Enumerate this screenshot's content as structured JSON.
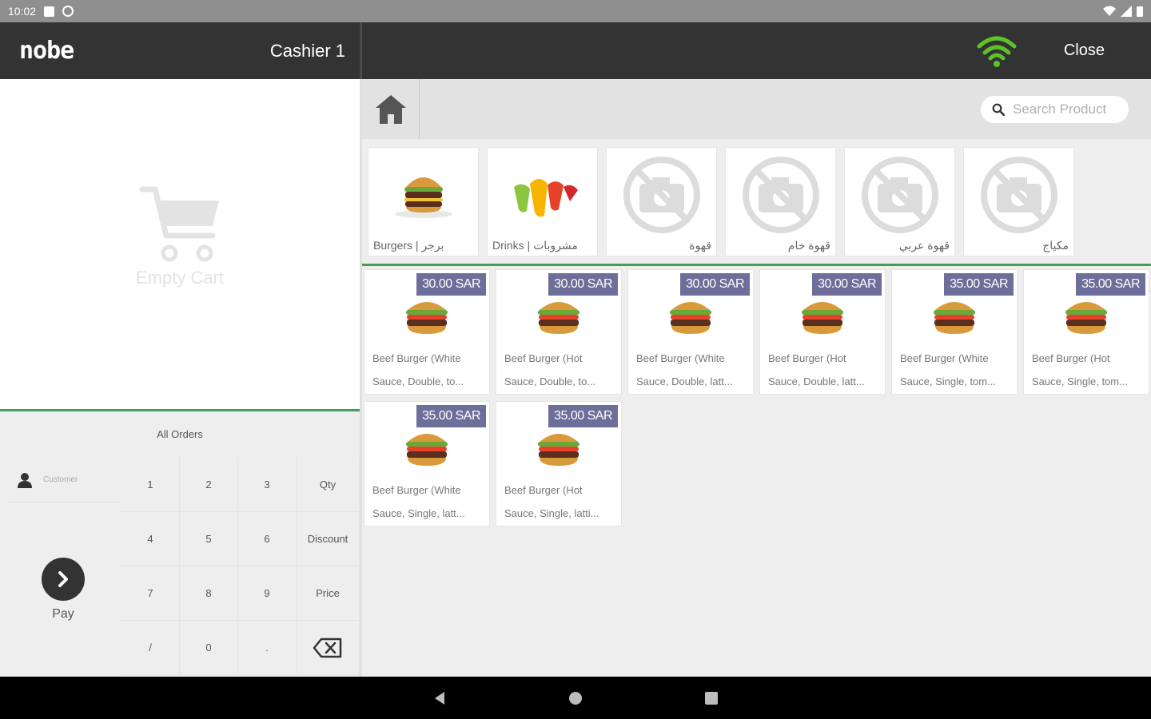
{
  "status_bar": {
    "time": "10:02"
  },
  "header": {
    "brand": "nobe",
    "cashier": "Cashier 1",
    "close_label": "Close",
    "wifi_color": "#5ec226"
  },
  "cart": {
    "empty_label": "Empty Cart"
  },
  "orders": {
    "all_orders_label": "All Orders"
  },
  "customer": {
    "label": "Customer"
  },
  "pay": {
    "label": "Pay"
  },
  "keypad": {
    "keys": [
      "1",
      "2",
      "3",
      "Qty",
      "4",
      "5",
      "6",
      "Discount",
      "7",
      "8",
      "9",
      "Price",
      "/",
      "0",
      "."
    ]
  },
  "search": {
    "placeholder": "Search Product"
  },
  "categories": [
    {
      "name": "Burgers | برجر",
      "image": "burger-icon"
    },
    {
      "name": "Drinks | مشروبات",
      "image": "drinks-icon"
    },
    {
      "name": "قهوة",
      "image": "no-photo-icon"
    },
    {
      "name": "قهوة خام",
      "image": "no-photo-icon"
    },
    {
      "name": "قهوة عربي",
      "image": "no-photo-icon"
    },
    {
      "name": "مكياج",
      "image": "no-photo-icon"
    }
  ],
  "products": [
    {
      "price": "30.00 SAR",
      "line1": "Beef Burger (White",
      "line2": "Sauce, Double, to..."
    },
    {
      "price": "30.00 SAR",
      "line1": "Beef Burger (Hot",
      "line2": "Sauce, Double, to..."
    },
    {
      "price": "30.00 SAR",
      "line1": "Beef Burger (White",
      "line2": "Sauce, Double, latt..."
    },
    {
      "price": "30.00 SAR",
      "line1": "Beef Burger (Hot",
      "line2": "Sauce, Double, latt..."
    },
    {
      "price": "35.00 SAR",
      "line1": "Beef Burger (White",
      "line2": "Sauce, Single, tom..."
    },
    {
      "price": "35.00 SAR",
      "line1": "Beef Burger (Hot",
      "line2": "Sauce, Single, tom..."
    },
    {
      "price": "35.00 SAR",
      "line1": "Beef Burger (White",
      "line2": "Sauce, Single, latt..."
    },
    {
      "price": "35.00 SAR",
      "line1": "Beef Burger (Hot",
      "line2": "Sauce, Single, latti..."
    }
  ],
  "colors": {
    "header_bg": "#333333",
    "accent_green": "#4a9a5b",
    "price_badge": "#6e6e9a"
  }
}
